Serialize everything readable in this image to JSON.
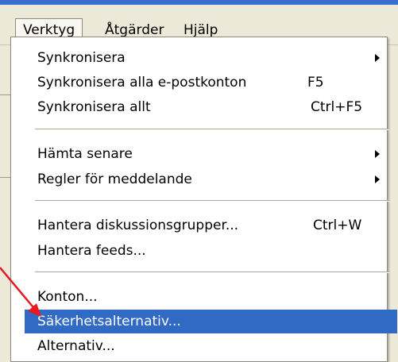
{
  "menubar": {
    "items": [
      {
        "label": "Verktyg"
      },
      {
        "label": "Åtgärder"
      },
      {
        "label": "Hjälp"
      }
    ]
  },
  "menu": {
    "items": [
      {
        "label": "Synkronisera",
        "shortcut": "",
        "submenu": true
      },
      {
        "label": "Synkronisera alla e-postkonton",
        "shortcut": "F5",
        "submenu": false
      },
      {
        "label": "Synkronisera allt",
        "shortcut": "Ctrl+F5",
        "submenu": false
      },
      {
        "label": "Hämta senare",
        "shortcut": "",
        "submenu": true
      },
      {
        "label": "Regler för meddelande",
        "shortcut": "",
        "submenu": true
      },
      {
        "label": "Hantera diskussionsgrupper...",
        "shortcut": "Ctrl+W",
        "submenu": false
      },
      {
        "label": "Hantera feeds...",
        "shortcut": "",
        "submenu": false
      },
      {
        "label": "Konton...",
        "shortcut": "",
        "submenu": false
      },
      {
        "label": "Säkerhetsalternativ...",
        "shortcut": "",
        "submenu": false,
        "highlighted": true
      },
      {
        "label": "Alternativ...",
        "shortcut": "",
        "submenu": false
      }
    ]
  },
  "colors": {
    "highlight": "#316ac5",
    "annotation_arrow": "#e8191f",
    "menubar_background": "#ece9d8"
  }
}
